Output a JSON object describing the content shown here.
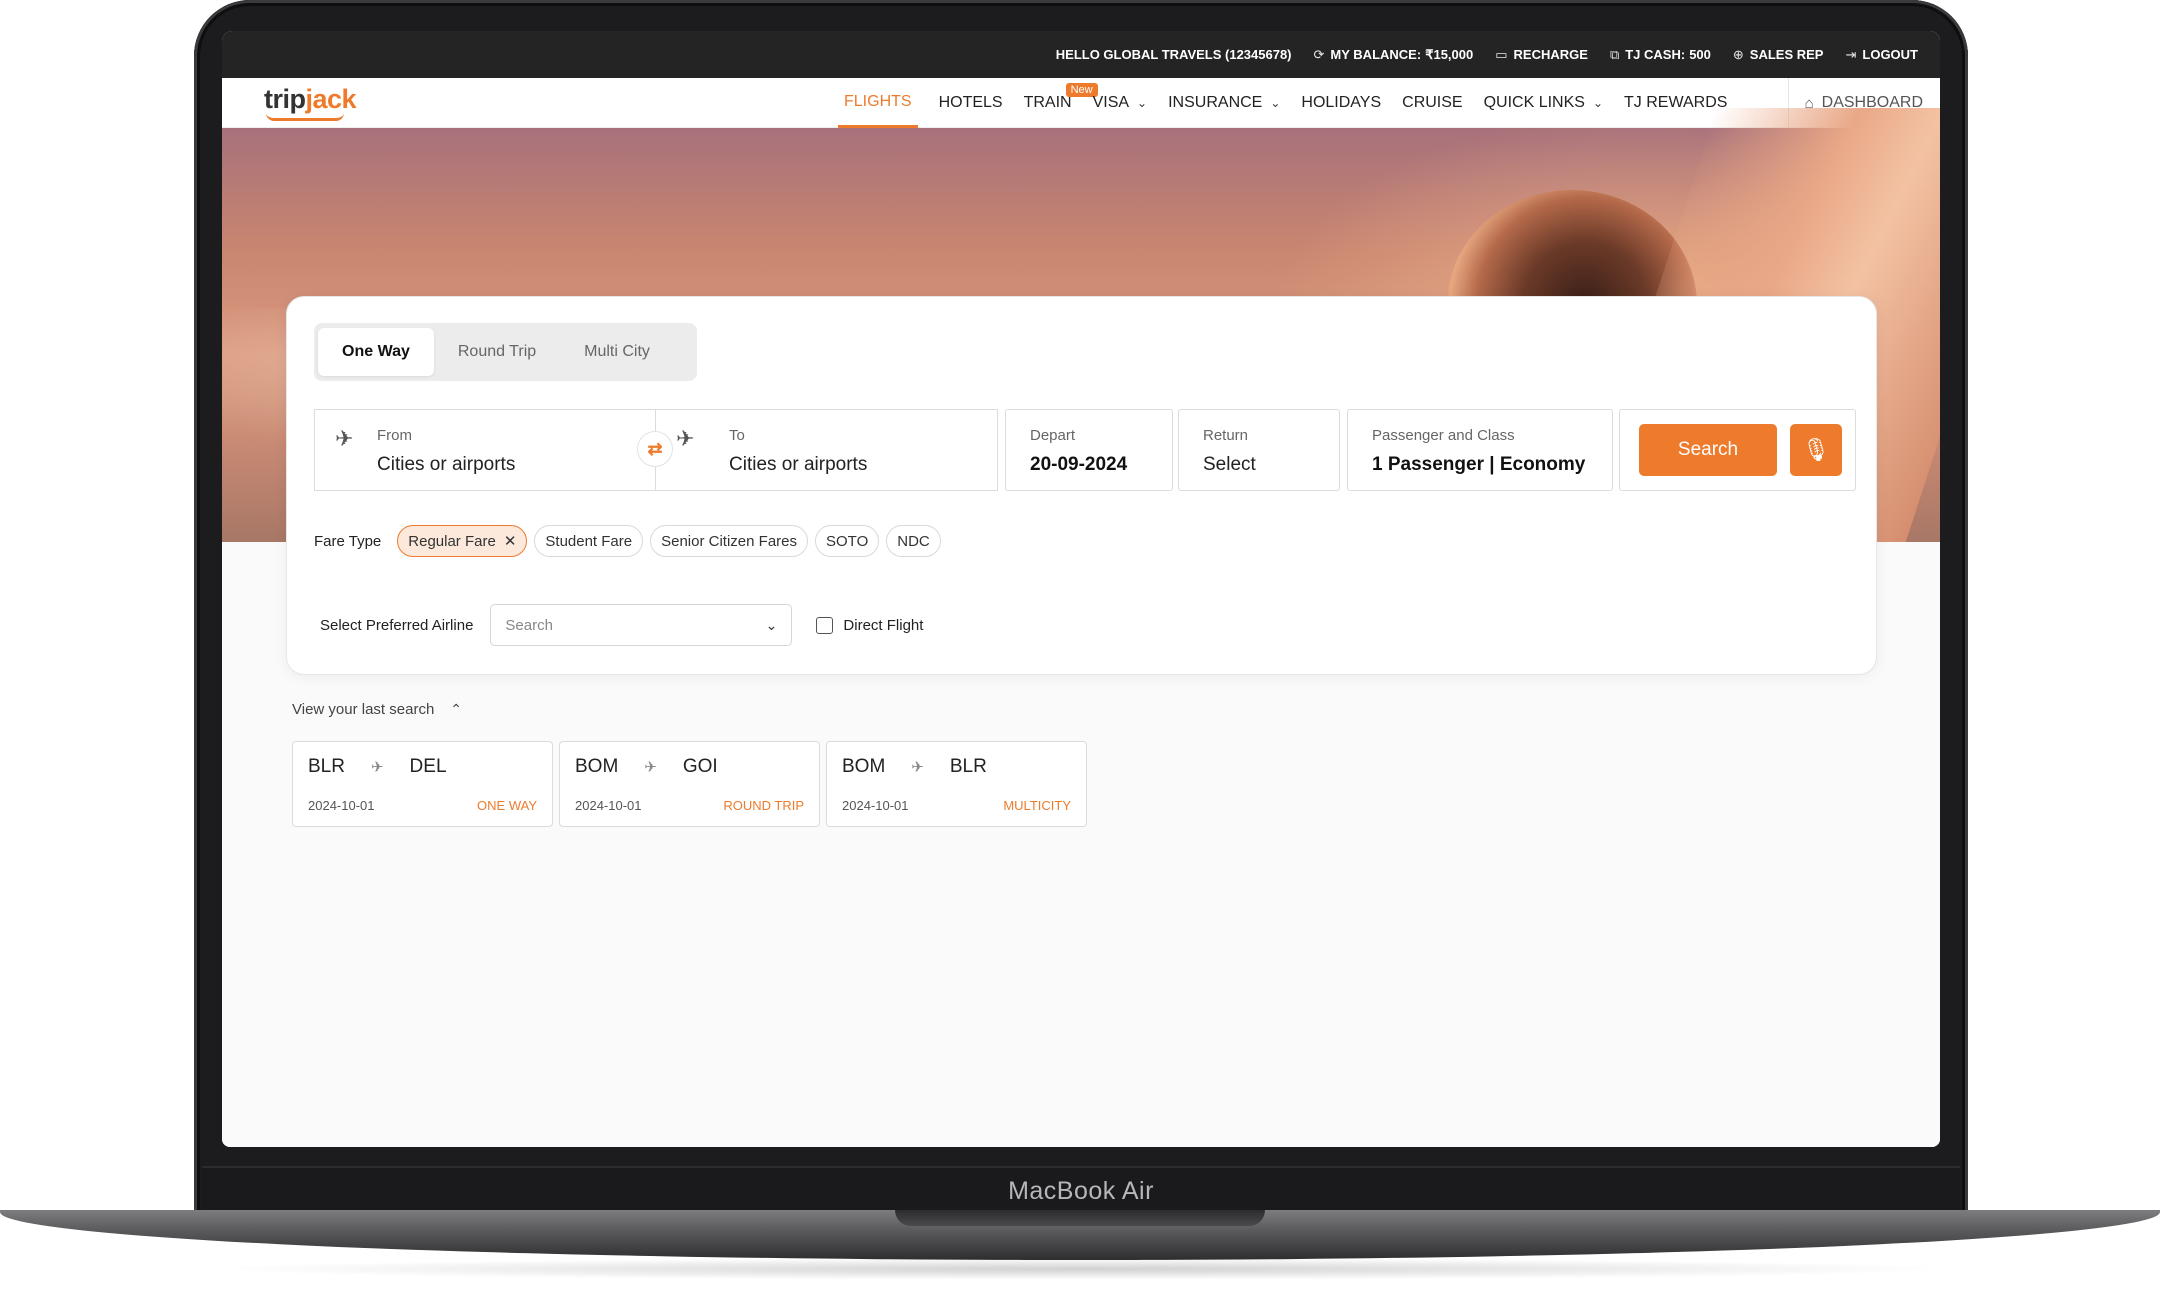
{
  "device": {
    "label": "MacBook Air"
  },
  "topbar": {
    "greeting": "HELLO GLOBAL TRAVELS (12345678)",
    "balance_label": "MY BALANCE:",
    "balance_value": "₹15,000",
    "recharge": "RECHARGE",
    "tj_cash_label": "TJ CASH:",
    "tj_cash_value": "500",
    "sales_rep": "SALES REP",
    "logout": "LOGOUT"
  },
  "navbar": {
    "logo_trip": "trip",
    "logo_jack": "jack",
    "items": [
      {
        "label": "FLIGHTS",
        "active": true
      },
      {
        "label": "HOTELS"
      },
      {
        "label": "TRAIN",
        "badge": "New"
      },
      {
        "label": "VISA",
        "dropdown": true
      },
      {
        "label": "INSURANCE",
        "dropdown": true
      },
      {
        "label": "HOLIDAYS"
      },
      {
        "label": "CRUISE"
      },
      {
        "label": "QUICK LINKS",
        "dropdown": true
      },
      {
        "label": "TJ REWARDS"
      }
    ],
    "dashboard": "DASHBOARD"
  },
  "search": {
    "trip_tabs": [
      "One Way",
      "Round Trip",
      "Multi City"
    ],
    "active_tab": "One Way",
    "from": {
      "label": "From",
      "placeholder": "Cities or airports"
    },
    "to": {
      "label": "To",
      "placeholder": "Cities or airports"
    },
    "depart": {
      "label": "Depart",
      "value": "20-09-2024"
    },
    "return": {
      "label": "Return",
      "value": "Select"
    },
    "passenger": {
      "label": "Passenger and Class",
      "value": "1 Passenger | Economy"
    },
    "search_button": "Search",
    "fare_type_label": "Fare Type",
    "fare_types": [
      "Regular Fare",
      "Student Fare",
      "Senior Citizen Fares",
      "SOTO",
      "NDC"
    ],
    "active_fare": "Regular Fare",
    "airline_label": "Select Preferred Airline",
    "airline_placeholder": "Search",
    "direct_flight_label": "Direct Flight"
  },
  "last_search": {
    "heading": "View your last search",
    "items": [
      {
        "from": "BLR",
        "to": "DEL",
        "date": "2024-10-01",
        "type": "ONE WAY"
      },
      {
        "from": "BOM",
        "to": "GOI",
        "date": "2024-10-01",
        "type": "ROUND TRIP"
      },
      {
        "from": "BOM",
        "to": "BLR",
        "date": "2024-10-01",
        "type": "MULTICITY"
      }
    ]
  },
  "colors": {
    "accent": "#ee7b2c",
    "topbar_bg": "#242424"
  },
  "icons": [
    "sync-icon",
    "card-icon",
    "coins-icon",
    "support-icon",
    "logout-icon",
    "home-icon",
    "takeoff-icon",
    "landing-icon",
    "swap-icon",
    "mic-icon",
    "plane-icon",
    "chevron-down-icon",
    "chevron-up-icon",
    "close-icon"
  ]
}
